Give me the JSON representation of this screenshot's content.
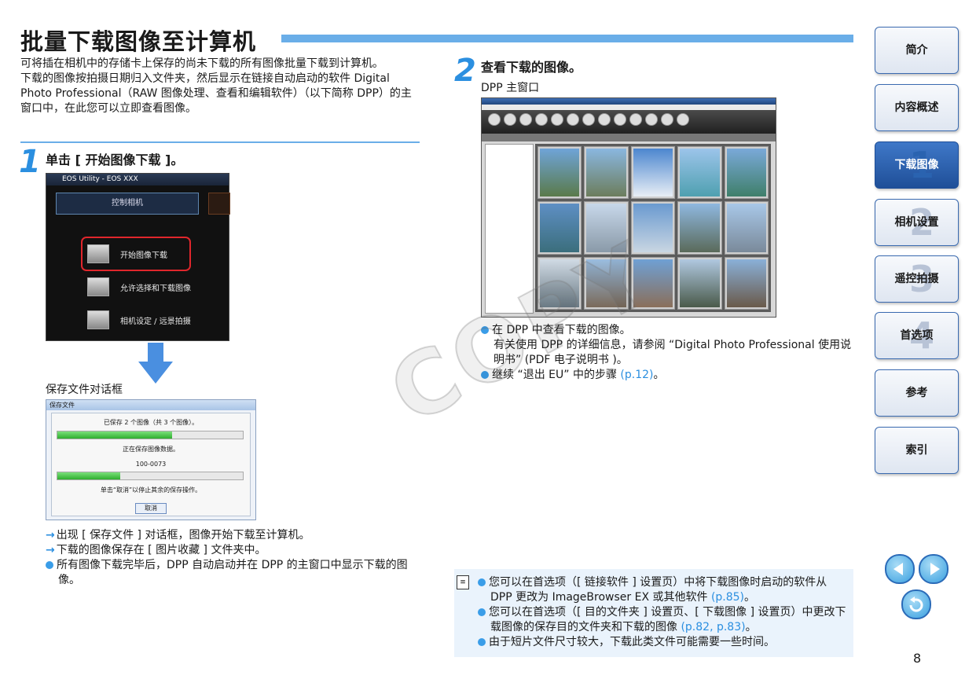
{
  "title": "批量下载图像至计算机",
  "intro": [
    "可将插在相机中的存储卡上保存的尚未下载的所有图像批量下载到计算机。",
    "下载的图像按拍摄日期归入文件夹，然后显示在链接自动启动的软件 Digital Photo Professional（RAW 图像处理、查看和编辑软件）（以下简称 DPP）的主窗口中，在此您可以立即查看图像。"
  ],
  "step1": {
    "number": "1",
    "text": "单击 [ 开始图像下载 ]。",
    "eu_window": {
      "title": "EOS Utility - EOS XXX",
      "control_label": "控制相机",
      "items": [
        "开始图像下载",
        "允许选择和下载图像",
        "相机设定 / 远景拍摄"
      ]
    },
    "dialog_caption": "保存文件对话框",
    "dialog": {
      "title": "保存文件",
      "status": "已保存 2 个图像（共 3 个图像）。",
      "saving": "正在保存图像数据。",
      "filename": "100-0073",
      "hint": "单击“取消”以停止其余的保存操作。",
      "cancel": "取消",
      "progress1": 0.62,
      "progress2": 0.34
    },
    "results": [
      "出现 [ 保存文件 ] 对话框，图像开始下载至计算机。",
      "下载的图像保存在 [ 图片收藏 ] 文件夹中。"
    ],
    "bullet": "所有图像下载完毕后，DPP 自动启动并在 DPP 的主窗口中显示下载的图像。"
  },
  "step2": {
    "number": "2",
    "text": "查看下载的图像。",
    "caption": "DPP 主窗口",
    "bullets": [
      "在 DPP 中查看下载的图像。",
      "有关使用 DPP 的详细信息，请参阅 “Digital Photo Professional 使用说明书” (PDF 电子说明书 )。"
    ],
    "continue_text": "继续 “退出 EU” 中的步骤 ",
    "continue_link": "(p.12)",
    "continue_end": "。"
  },
  "watermark": "COPY",
  "notes": [
    {
      "text": "您可以在首选项（[ 链接软件 ] 设置页）中将下载图像时启动的软件从 DPP 更改为 ImageBrowser EX 或其他软件 ",
      "link": "(p.85)",
      "end": "。"
    },
    {
      "text": "您可以在首选项（[ 目的文件夹 ] 设置页、[ 下载图像 ] 设置页）中更改下载图像的保存目的文件夹和下载的图像 ",
      "link": "(p.82, p.83)",
      "end": "。"
    },
    {
      "text": "由于短片文件尺寸较大，下载此类文件可能需要一些时间。",
      "link": "",
      "end": ""
    }
  ],
  "sidebar": [
    {
      "label": "简介",
      "num": ""
    },
    {
      "label": "内容概述",
      "num": ""
    },
    {
      "label": "下载图像",
      "num": "1"
    },
    {
      "label": "相机设置",
      "num": "2"
    },
    {
      "label": "遥控拍摄",
      "num": "3"
    },
    {
      "label": "首选项",
      "num": "4"
    },
    {
      "label": "参考",
      "num": ""
    },
    {
      "label": "索引",
      "num": ""
    }
  ],
  "page_number": "8",
  "colors": {
    "accent": "#2b8fe0",
    "title_bar": "#6aaee8",
    "active_tab": "#1f4f98",
    "highlight": "#e0262c"
  }
}
